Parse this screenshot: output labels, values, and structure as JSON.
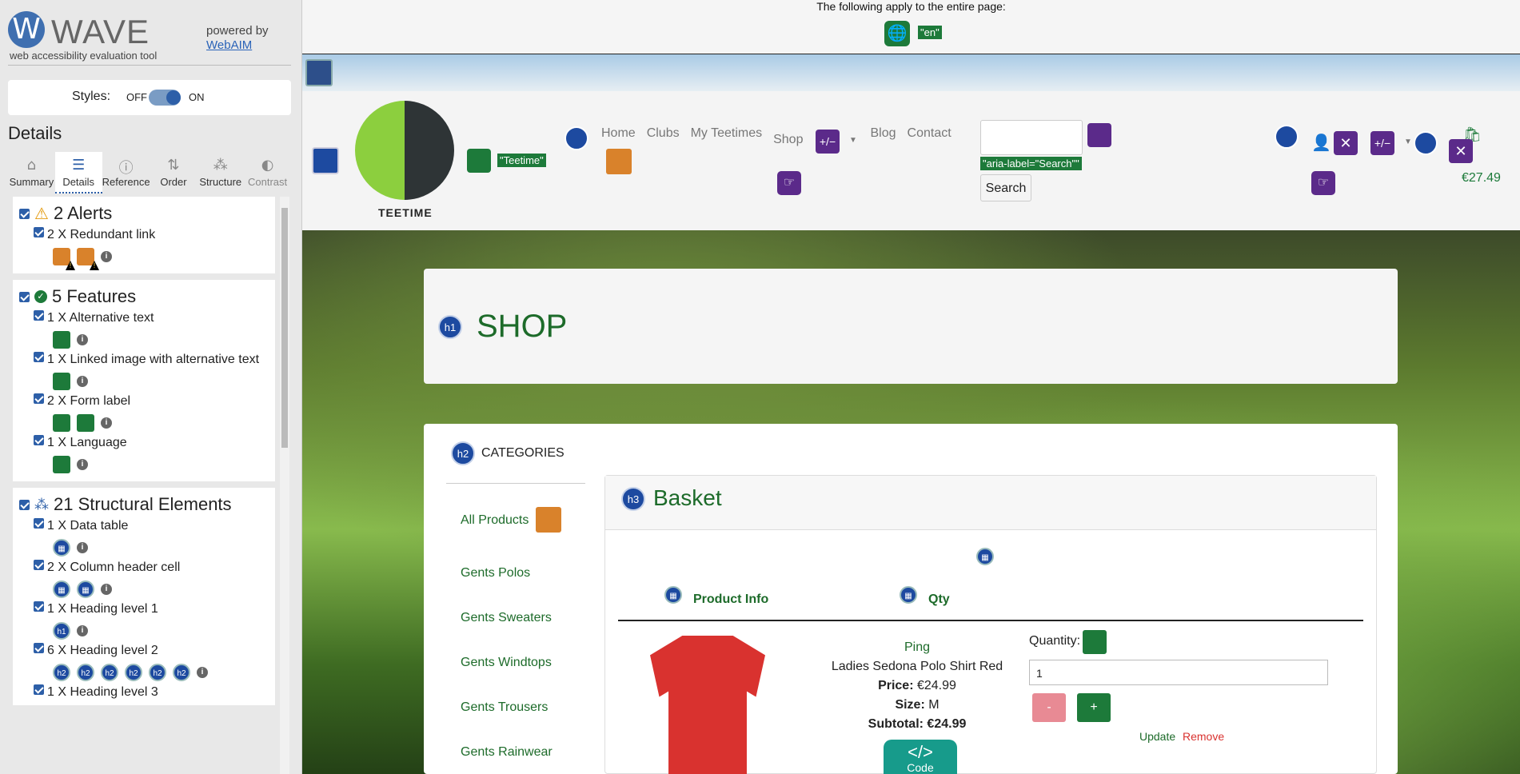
{
  "wave": {
    "logo_letter": "W",
    "logo_title": "WAVE",
    "logo_subtitle": "web accessibility evaluation tool",
    "powered_by": "powered by",
    "webaim_link": "WebAIM",
    "styles_label": "Styles:",
    "styles_off": "OFF",
    "styles_on": "ON",
    "details_heading": "Details",
    "tabs": [
      {
        "label": "Summary",
        "icon": "home-icon",
        "glyph": "⌂"
      },
      {
        "label": "Details",
        "icon": "list-icon",
        "glyph": "☰"
      },
      {
        "label": "Reference",
        "icon": "info-icon",
        "glyph": "ⓘ"
      },
      {
        "label": "Order",
        "icon": "order-icon",
        "glyph": "⇅"
      },
      {
        "label": "Structure",
        "icon": "structure-icon",
        "glyph": "⁂"
      },
      {
        "label": "Contrast",
        "icon": "contrast-icon",
        "glyph": "◐"
      }
    ],
    "groups": {
      "alerts": {
        "title": "2 Alerts",
        "items": [
          {
            "label": "2 X Redundant link"
          }
        ]
      },
      "features": {
        "title": "5 Features",
        "items": [
          {
            "label": "1 X Alternative text"
          },
          {
            "label": "1 X Linked image with alternative text"
          },
          {
            "label": "2 X Form label"
          },
          {
            "label": "1 X Language"
          }
        ]
      },
      "structure": {
        "title": "21 Structural Elements",
        "items": [
          {
            "label": "1 X Data table"
          },
          {
            "label": "2 X Column header cell"
          },
          {
            "label": "1 X Heading level 1"
          },
          {
            "label": "6 X Heading level 2"
          },
          {
            "label": "1 X Heading level 3"
          }
        ]
      },
      "heading_badges": {
        "h1": "h1",
        "h2": "h2"
      }
    }
  },
  "page": {
    "doc_notice": "The following apply to the entire page:",
    "lang_tag": "\"en\"",
    "logo_alt_tag": "\"Teetime\"",
    "logo_text": "TEETIME",
    "nav": [
      "Home",
      "Clubs",
      "My Teetimes",
      "Shop",
      "Blog",
      "Contact"
    ],
    "shop_menu_glyph": "+/−",
    "aria_label_tag": "\"aria-label=\"Search\"\"",
    "search_button": "Search",
    "cart_total": "€27.49",
    "h1_badge": "h1",
    "shop_title": "SHOP",
    "h2_badge": "h2",
    "categories_title": "CATEGORIES",
    "categories": [
      "All Products",
      "Gents Polos",
      "Gents Sweaters",
      "Gents Windtops",
      "Gents Trousers",
      "Gents Rainwear"
    ],
    "h3_badge": "h3",
    "basket_title": "Basket",
    "th_product": "Product Info",
    "th_qty": "Qty",
    "product": {
      "brand": "Ping",
      "name": "Ladies Sedona Polo Shirt Red",
      "price_label": "Price:",
      "price": "€24.99",
      "size_label": "Size:",
      "size": "M",
      "subtotal_label": "Subtotal:",
      "subtotal": "€24.99"
    },
    "code_icon_glyph": "</>",
    "code_label": "Code",
    "quantity_label": "Quantity:",
    "quantity_value": "1",
    "minus_label": "-",
    "plus_label": "+",
    "update_label": "Update",
    "remove_label": "Remove"
  },
  "colors": {
    "wave_blue": "#2d5fa8",
    "feature_green": "#1d7a3a",
    "alert_orange": "#d9822b",
    "aria_purple": "#5b2a8a",
    "site_green": "#1d6b2a"
  }
}
